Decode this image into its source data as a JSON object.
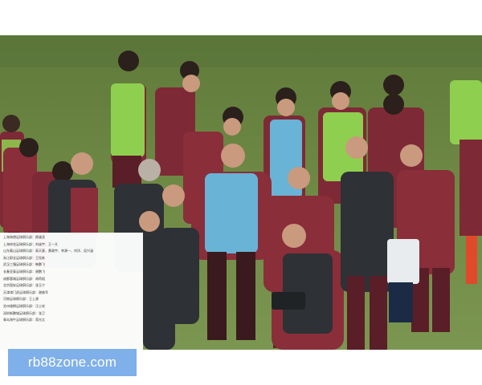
{
  "overlay_list": {
    "rows": [
      "上海海港足球俱乐部：颜骏凌",
      "上海申花足球俱乐部：刘诚宇、王一凡",
      "山东泰山足球俱乐部：高天意、黄政宇、李源一、刘洋、吴兴涵",
      "浙江职业足球俱乐部：王钰栋",
      "武汉三镇足球俱乐部：韩鹏飞",
      "长春亚泰足球俱乐部：谢鹏飞",
      "成都蓉城足球俱乐部：胡荷韬",
      "北京国安足球俱乐部：张玉宁",
      "天津津门虎足球俱乐部：谢维军",
      "河南足球俱乐部：王上源",
      "沧州雄狮足球俱乐部：汪士钦",
      "深圳新鹏城足球俱乐部：张卫",
      "青岛海牛足球俱乐部：蒋光太"
    ]
  },
  "watermark": {
    "text": "rb88zone.com"
  },
  "colors": {
    "pitch": "#6f8a45",
    "kit_red": "#7e2a36",
    "bib_green": "#8fcf4f",
    "bib_blue": "#69b3d6",
    "banner": "#7fb0ea"
  }
}
